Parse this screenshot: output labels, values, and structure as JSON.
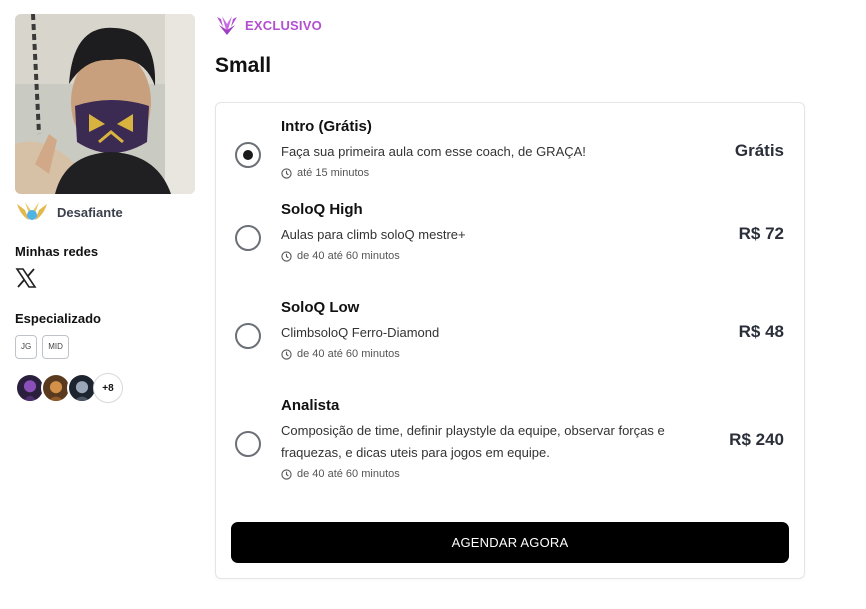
{
  "profile": {
    "rank_label": "Desafiante",
    "networks_title": "Minhas redes",
    "networks": [
      {
        "icon": "x-twitter-icon"
      }
    ],
    "specialized_title": "Especializado",
    "roles": [
      "JG",
      "MID"
    ],
    "champions_more": "+8"
  },
  "header": {
    "badge_icon": "exclusive-crest-icon",
    "badge_label": "EXCLUSIVO",
    "title": "Small"
  },
  "plans": [
    {
      "name": "Intro (Grátis)",
      "description": "Faça sua primeira aula com esse coach, de GRAÇA!",
      "duration": "até 15 minutos",
      "price": "Grátis",
      "selected": true
    },
    {
      "name": "SoloQ High",
      "description": "Aulas para climb soloQ mestre+",
      "duration": "de 40 até 60 minutos",
      "price": "R$ 72",
      "selected": false
    },
    {
      "name": "SoloQ Low",
      "description": "ClimbsoloQ Ferro-Diamond",
      "duration": "de 40 até 60 minutos",
      "price": "R$ 48",
      "selected": false
    },
    {
      "name": "Analista",
      "description": "Composição de time, definir playstyle da equipe, observar forças e fraquezas, e dicas uteis para jogos em equipe.",
      "duration": "de 40 até 60 minutos",
      "price": "R$ 240",
      "selected": false
    }
  ],
  "cta_label": "AGENDAR AGORA",
  "colors": {
    "accent": "#b34fd0",
    "cta_bg": "#000000",
    "price": "#2a2f3a"
  }
}
